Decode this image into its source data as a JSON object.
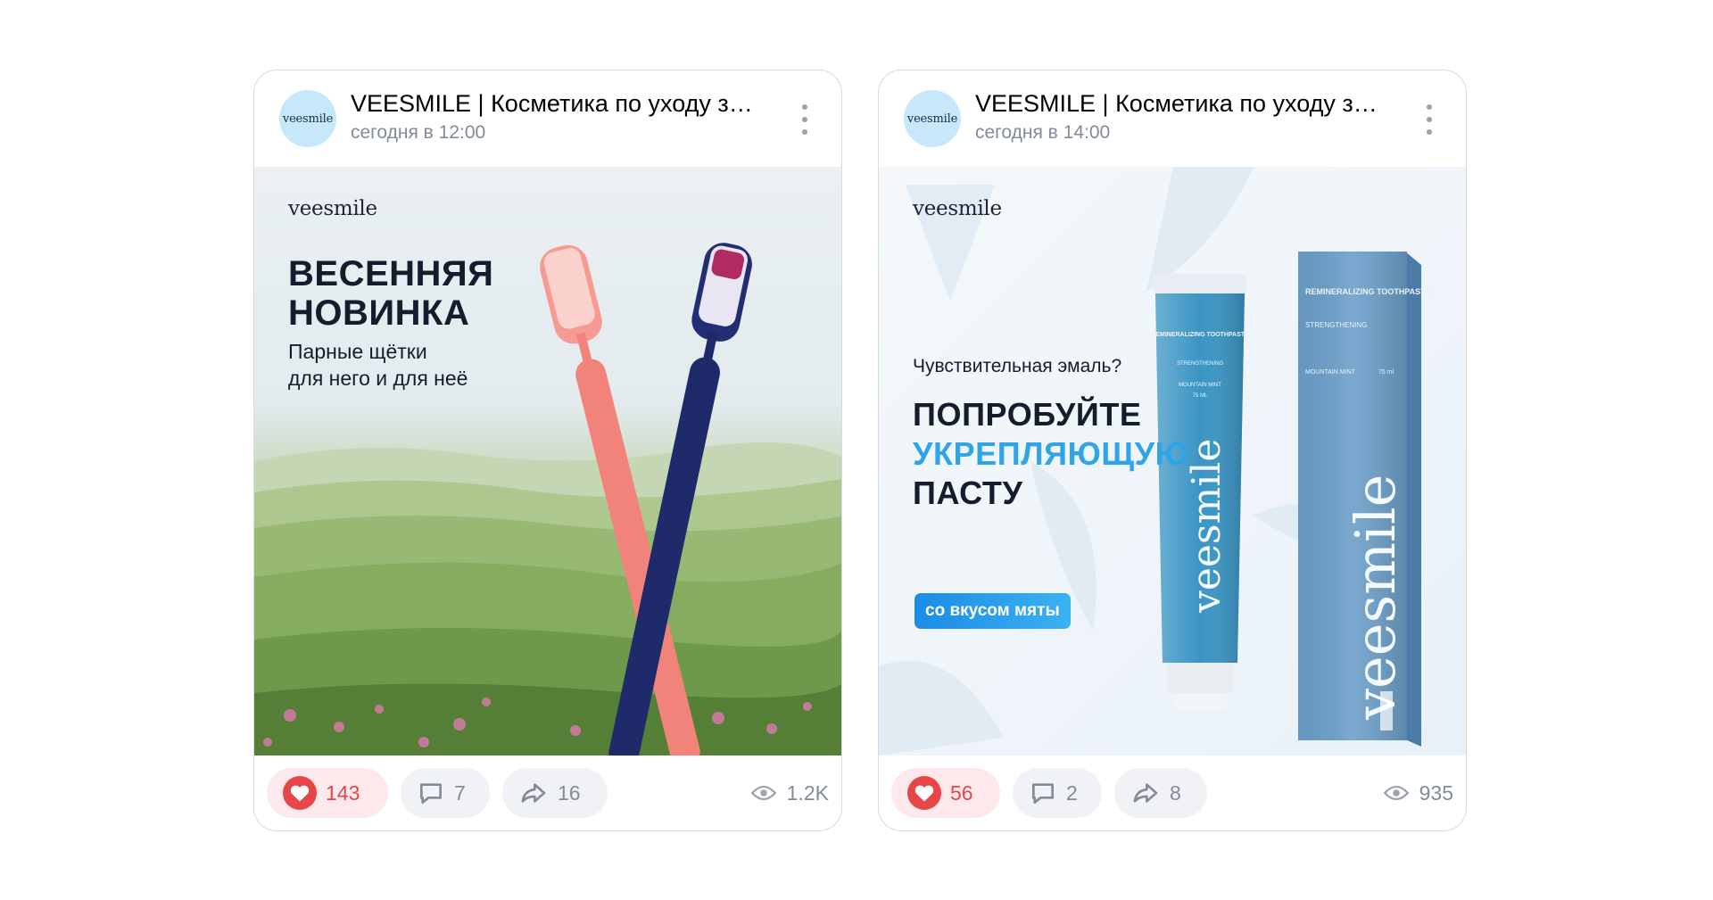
{
  "posts": [
    {
      "author": "VEESMILE | Косметика по уходу за полостью рта",
      "avatar_text": "veesmile",
      "time": "сегодня в 12:00",
      "banner": {
        "brand": "veesmile",
        "headline_line1": "ВЕСЕННЯЯ",
        "headline_line2": "НОВИНКА",
        "sub_line1": "Парные щётки",
        "sub_line2": "для него и для неё"
      },
      "likes": "143",
      "comments": "7",
      "shares": "16",
      "views": "1.2K"
    },
    {
      "author": "VEESMILE | Косметика по уходу за полостью рта",
      "avatar_text": "veesmile",
      "time": "сегодня в 14:00",
      "banner": {
        "brand": "veesmile",
        "question": "Чувствительная эмаль?",
        "line1": "ПОПРОБУЙТЕ",
        "line2": "УКРЕПЛЯЮЩУЮ",
        "line3": "ПАСТУ",
        "pill": "со вкусом мяты",
        "tube_title": "REMINERALIZING TOOTHPASTE",
        "tube_sub": "STRENGTHENING",
        "tube_flavor": "MOUNTAIN MINT",
        "tube_vol": "75 ML",
        "tube_brand": "veesmile",
        "box_title": "REMINERALIZING TOOTHPASTE",
        "box_sub": "STRENGTHENING",
        "box_flavor": "MOUNTAIN MINT",
        "box_vol": "75 ml",
        "box_brand": "veesmile"
      },
      "likes": "56",
      "comments": "2",
      "shares": "8",
      "views": "935"
    }
  ],
  "colors": {
    "like": "#e64646",
    "accent": "#2fa4e7",
    "muted": "#818c99"
  },
  "icons": [
    "more-vertical-icon",
    "heart-icon",
    "comment-icon",
    "share-icon",
    "eye-icon"
  ]
}
